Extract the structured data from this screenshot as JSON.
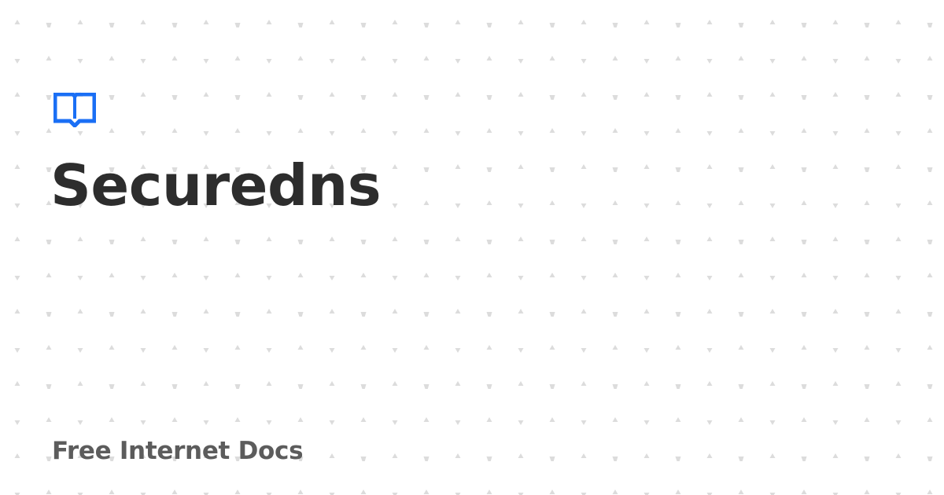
{
  "title": "Securedns",
  "site_name": "Free Internet Docs",
  "colors": {
    "background": "#ffffff",
    "accent": "#1a6ff5",
    "title": "#2d2d2d",
    "site_name": "#5c5c5c",
    "pattern": "#dcdcdc"
  },
  "icons": {
    "logo": "open-book-icon",
    "pattern_glyph": "triangle-dot-icon"
  }
}
